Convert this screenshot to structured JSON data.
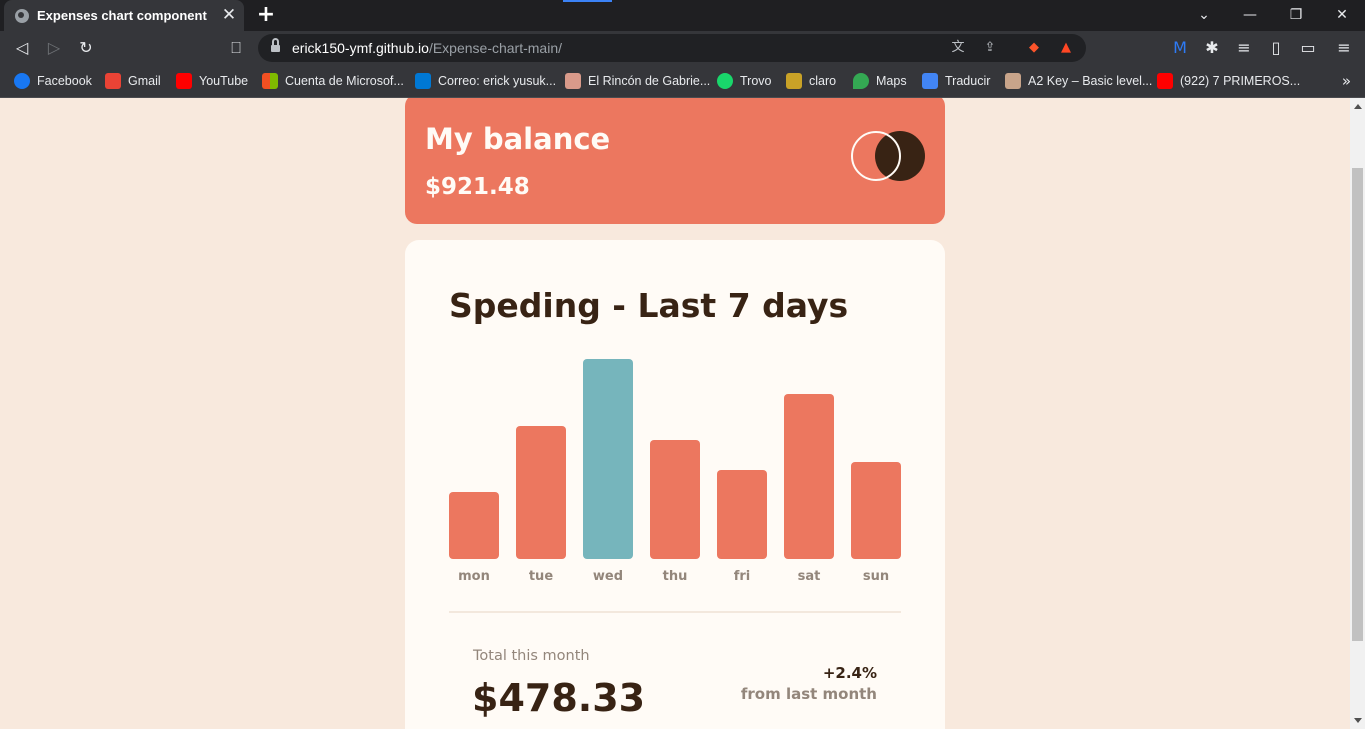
{
  "browser": {
    "tab_title": "Expenses chart component",
    "url_host": "erick150-ymf.github.io",
    "url_path": "/Expense-chart-main/",
    "bookmarks": [
      {
        "label": "Facebook",
        "icon": "facebook-icon",
        "color": "#1877f2"
      },
      {
        "label": "Gmail",
        "icon": "gmail-icon",
        "color": "#ea4335"
      },
      {
        "label": "YouTube",
        "icon": "youtube-icon",
        "color": "#ff0000"
      },
      {
        "label": "Cuenta de Microsof...",
        "icon": "microsoft-icon",
        "color": "#f25022"
      },
      {
        "label": "Correo: erick yusuk...",
        "icon": "outlook-icon",
        "color": "#0078d4"
      },
      {
        "label": "El Rincón de Gabrie...",
        "icon": "rincon-icon",
        "color": "#d99a8a"
      },
      {
        "label": "Trovo",
        "icon": "trovo-icon",
        "color": "#19d66b"
      },
      {
        "label": "claro",
        "icon": "claro-icon",
        "color": "#c9a227"
      },
      {
        "label": "Maps",
        "icon": "maps-icon",
        "color": "#34a853"
      },
      {
        "label": "Traducir",
        "icon": "translate-icon",
        "color": "#4285f4"
      },
      {
        "label": "A2 Key – Basic level...",
        "icon": "cambridge-icon",
        "color": "#c8a48a"
      },
      {
        "label": "(922) 7 PRIMEROS...",
        "icon": "youtube-icon",
        "color": "#ff0000"
      }
    ]
  },
  "balance": {
    "label": "My balance",
    "amount": "$921.48"
  },
  "spending": {
    "title": "Speding - Last 7 days",
    "total_label": "Total this month",
    "total_amount": "$478.33",
    "change": "+2.4%",
    "change_label": "from last month"
  },
  "colors": {
    "bar": "#ec775f",
    "bar_highlight": "#76b5bc",
    "day_label": "#93867b"
  },
  "chart_data": {
    "type": "bar",
    "categories": [
      "mon",
      "tue",
      "wed",
      "thu",
      "fri",
      "sat",
      "sun"
    ],
    "values": [
      17.45,
      34.91,
      52.36,
      31.07,
      23.39,
      43.28,
      25.48
    ],
    "highlight": "wed",
    "title": "Speding - Last 7 days",
    "xlabel": "",
    "ylabel": "",
    "ylim": [
      0,
      52.36
    ],
    "grid": false
  }
}
